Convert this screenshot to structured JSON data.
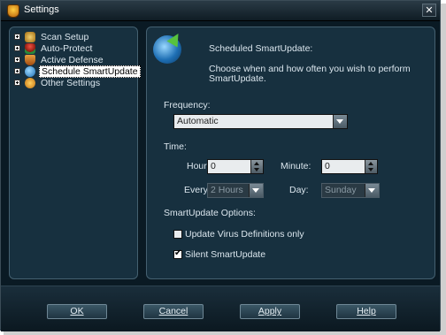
{
  "window": {
    "title": "Settings",
    "close_label": "✕"
  },
  "sidebar": {
    "items": [
      {
        "label": "Scan Setup",
        "icon": "scan-setup-icon",
        "icon_color": "#c8a040"
      },
      {
        "label": "Auto-Protect",
        "icon": "auto-protect-icon",
        "icon_color": "#d9382a"
      },
      {
        "label": "Active Defense",
        "icon": "active-defense-icon",
        "icon_color": "#d88a2a"
      },
      {
        "label": "Schedule SmartUpdate",
        "icon": "smartupdate-icon",
        "icon_color": "#3aa8e0",
        "selected": true
      },
      {
        "label": "Other Settings",
        "icon": "other-settings-icon",
        "icon_color": "#e0a020"
      }
    ]
  },
  "main": {
    "heading": "Scheduled SmartUpdate:",
    "description_line1": "Choose when and how often you wish to perform",
    "description_line2": "SmartUpdate.",
    "frequency_label": "Frequency:",
    "frequency_value": "Automatic",
    "time_label": "Time:",
    "hour_label": "Hour:",
    "hour_value": "0",
    "minute_label": "Minute:",
    "minute_value": "0",
    "every_label": "Every:",
    "every_value": "2 Hours",
    "day_label": "Day:",
    "day_value": "Sunday",
    "options_label": "SmartUpdate Options:",
    "option_virus_defs": "Update Virus Definitions only",
    "option_virus_defs_checked": false,
    "option_silent": "Silent SmartUpdate",
    "option_silent_checked": true
  },
  "buttons": {
    "ok": "OK",
    "cancel": "Cancel",
    "apply": "Apply",
    "help": "Help"
  }
}
